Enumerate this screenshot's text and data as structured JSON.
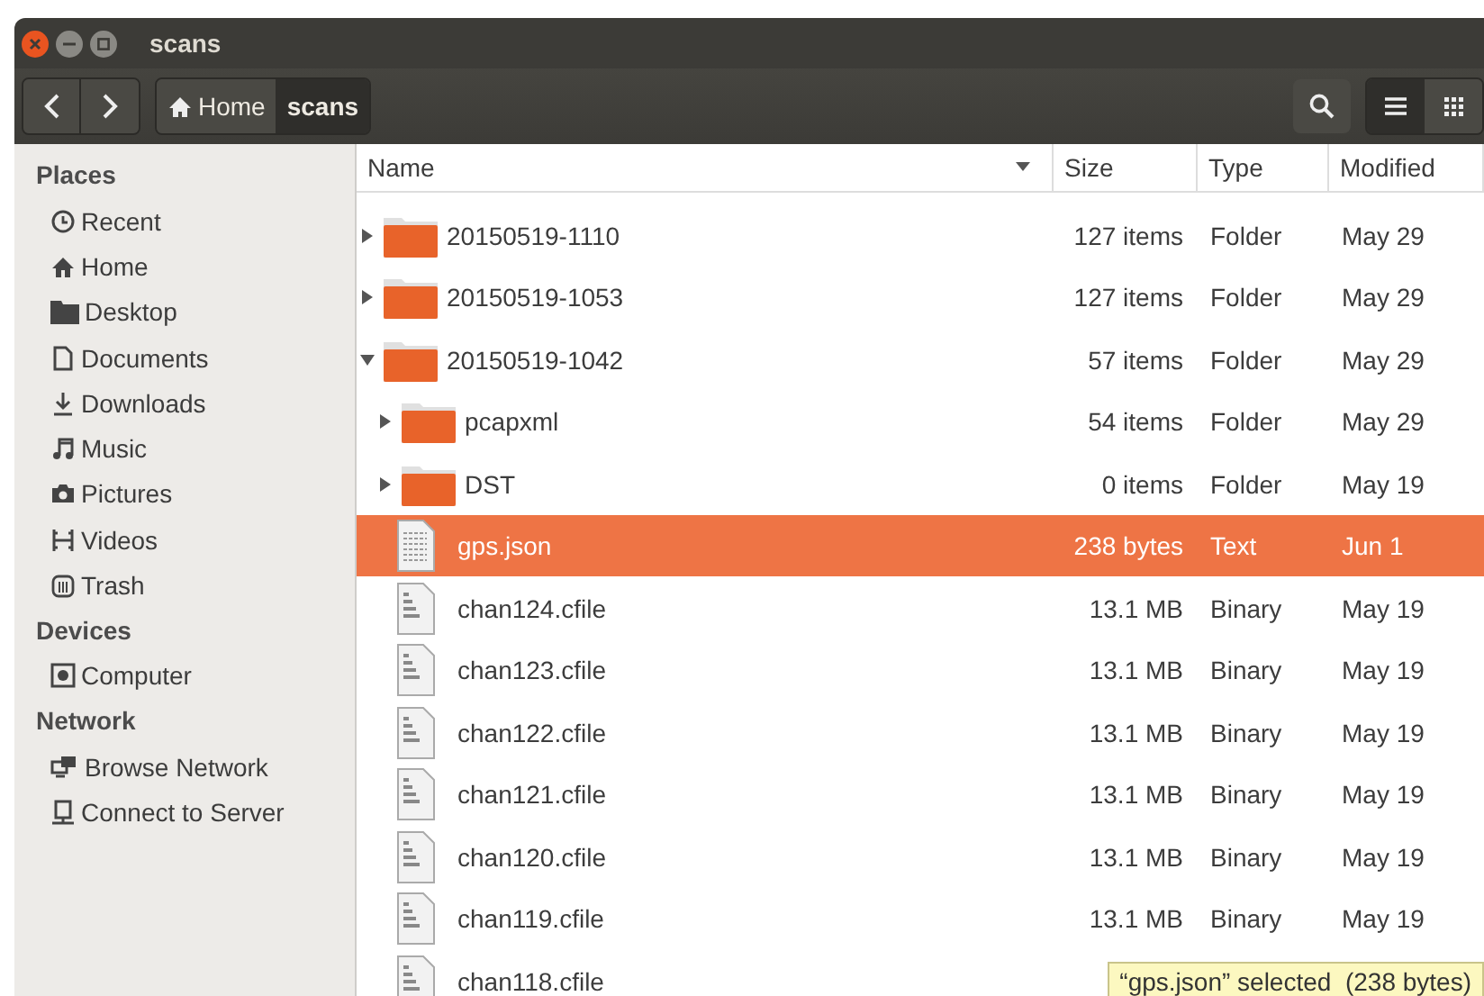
{
  "window": {
    "title": "scans"
  },
  "breadcrumbs": [
    {
      "label": "Home",
      "selected": false
    },
    {
      "label": "scans",
      "selected": true
    }
  ],
  "view_buttons": [
    {
      "kind": "list",
      "selected": true
    },
    {
      "kind": "grid",
      "selected": false
    }
  ],
  "sidebar": [
    {
      "heading": "Places",
      "items": [
        {
          "label": "Recent",
          "selected": false
        },
        {
          "label": "Home",
          "selected": false
        },
        {
          "label": "Desktop",
          "selected": false
        },
        {
          "label": "Documents",
          "selected": false
        },
        {
          "label": "Downloads",
          "selected": false
        },
        {
          "label": "Music",
          "selected": false
        },
        {
          "label": "Pictures",
          "selected": false
        },
        {
          "label": "Videos",
          "selected": false
        },
        {
          "label": "Trash",
          "selected": false
        }
      ]
    },
    {
      "heading": "Devices",
      "items": [
        {
          "label": "Computer",
          "selected": false
        }
      ]
    },
    {
      "heading": "Network",
      "items": [
        {
          "label": "Browse Network",
          "selected": false
        },
        {
          "label": "Connect to Server",
          "selected": false
        }
      ]
    }
  ],
  "table": {
    "columns": [
      "Name",
      "Size",
      "Type",
      "Modified"
    ],
    "rows": [
      {
        "kind": "folder",
        "name": "20150519-1110",
        "size": "127 items",
        "type": "Folder",
        "modified": "May 29",
        "expanded": false,
        "selected": false
      },
      {
        "kind": "folder",
        "name": "20150519-1053",
        "size": "127 items",
        "type": "Folder",
        "modified": "May 29",
        "expanded": false,
        "selected": false
      },
      {
        "kind": "folder",
        "name": "20150519-1042",
        "size": "57 items",
        "type": "Folder",
        "modified": "May 29",
        "expanded": true,
        "selected": false,
        "children": [
          {
            "kind": "folder",
            "name": "pcapxml",
            "size": "54 items",
            "type": "Folder",
            "modified": "May 29",
            "expanded": false,
            "selected": false
          },
          {
            "kind": "folder",
            "name": "DST",
            "size": "0 items",
            "type": "Folder",
            "modified": "May 19",
            "expanded": false,
            "selected": false
          },
          {
            "kind": "text",
            "name": "gps.json",
            "size": "238 bytes",
            "type": "Text",
            "modified": "Jun 1",
            "selected": true
          },
          {
            "kind": "binary",
            "name": "chan124.cfile",
            "size": "13.1 MB",
            "type": "Binary",
            "modified": "May 19",
            "selected": false
          },
          {
            "kind": "binary",
            "name": "chan123.cfile",
            "size": "13.1 MB",
            "type": "Binary",
            "modified": "May 19",
            "selected": false
          },
          {
            "kind": "binary",
            "name": "chan122.cfile",
            "size": "13.1 MB",
            "type": "Binary",
            "modified": "May 19",
            "selected": false
          },
          {
            "kind": "binary",
            "name": "chan121.cfile",
            "size": "13.1 MB",
            "type": "Binary",
            "modified": "May 19",
            "selected": false
          },
          {
            "kind": "binary",
            "name": "chan120.cfile",
            "size": "13.1 MB",
            "type": "Binary",
            "modified": "May 19",
            "selected": false
          },
          {
            "kind": "binary",
            "name": "chan119.cfile",
            "size": "13.1 MB",
            "type": "Binary",
            "modified": "May 19",
            "selected": false
          },
          {
            "kind": "binary",
            "name": "chan118.cfile",
            "selected": false
          }
        ]
      }
    ]
  },
  "status": "“gps.json” selected  (238 bytes)"
}
